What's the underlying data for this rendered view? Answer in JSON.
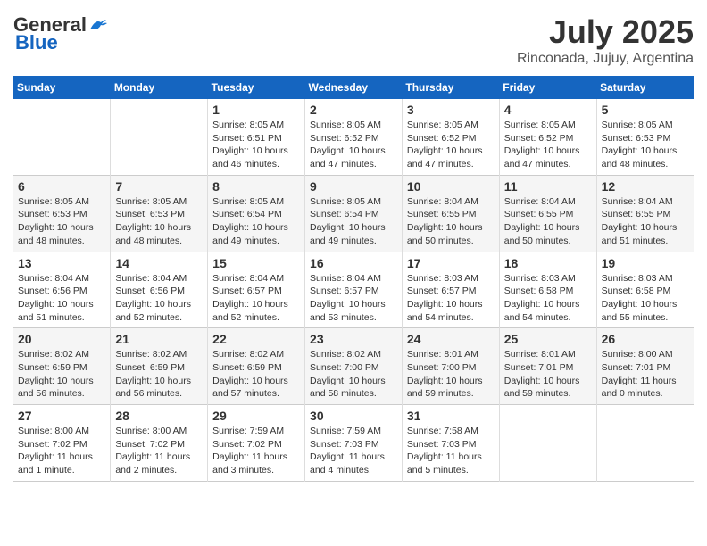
{
  "header": {
    "logo_general": "General",
    "logo_blue": "Blue",
    "month_title": "July 2025",
    "subtitle": "Rinconada, Jujuy, Argentina"
  },
  "days_of_week": [
    "Sunday",
    "Monday",
    "Tuesday",
    "Wednesday",
    "Thursday",
    "Friday",
    "Saturday"
  ],
  "weeks": [
    [
      {
        "day": "",
        "info": ""
      },
      {
        "day": "",
        "info": ""
      },
      {
        "day": "1",
        "info": "Sunrise: 8:05 AM\nSunset: 6:51 PM\nDaylight: 10 hours and 46 minutes."
      },
      {
        "day": "2",
        "info": "Sunrise: 8:05 AM\nSunset: 6:52 PM\nDaylight: 10 hours and 47 minutes."
      },
      {
        "day": "3",
        "info": "Sunrise: 8:05 AM\nSunset: 6:52 PM\nDaylight: 10 hours and 47 minutes."
      },
      {
        "day": "4",
        "info": "Sunrise: 8:05 AM\nSunset: 6:52 PM\nDaylight: 10 hours and 47 minutes."
      },
      {
        "day": "5",
        "info": "Sunrise: 8:05 AM\nSunset: 6:53 PM\nDaylight: 10 hours and 48 minutes."
      }
    ],
    [
      {
        "day": "6",
        "info": "Sunrise: 8:05 AM\nSunset: 6:53 PM\nDaylight: 10 hours and 48 minutes."
      },
      {
        "day": "7",
        "info": "Sunrise: 8:05 AM\nSunset: 6:53 PM\nDaylight: 10 hours and 48 minutes."
      },
      {
        "day": "8",
        "info": "Sunrise: 8:05 AM\nSunset: 6:54 PM\nDaylight: 10 hours and 49 minutes."
      },
      {
        "day": "9",
        "info": "Sunrise: 8:05 AM\nSunset: 6:54 PM\nDaylight: 10 hours and 49 minutes."
      },
      {
        "day": "10",
        "info": "Sunrise: 8:04 AM\nSunset: 6:55 PM\nDaylight: 10 hours and 50 minutes."
      },
      {
        "day": "11",
        "info": "Sunrise: 8:04 AM\nSunset: 6:55 PM\nDaylight: 10 hours and 50 minutes."
      },
      {
        "day": "12",
        "info": "Sunrise: 8:04 AM\nSunset: 6:55 PM\nDaylight: 10 hours and 51 minutes."
      }
    ],
    [
      {
        "day": "13",
        "info": "Sunrise: 8:04 AM\nSunset: 6:56 PM\nDaylight: 10 hours and 51 minutes."
      },
      {
        "day": "14",
        "info": "Sunrise: 8:04 AM\nSunset: 6:56 PM\nDaylight: 10 hours and 52 minutes."
      },
      {
        "day": "15",
        "info": "Sunrise: 8:04 AM\nSunset: 6:57 PM\nDaylight: 10 hours and 52 minutes."
      },
      {
        "day": "16",
        "info": "Sunrise: 8:04 AM\nSunset: 6:57 PM\nDaylight: 10 hours and 53 minutes."
      },
      {
        "day": "17",
        "info": "Sunrise: 8:03 AM\nSunset: 6:57 PM\nDaylight: 10 hours and 54 minutes."
      },
      {
        "day": "18",
        "info": "Sunrise: 8:03 AM\nSunset: 6:58 PM\nDaylight: 10 hours and 54 minutes."
      },
      {
        "day": "19",
        "info": "Sunrise: 8:03 AM\nSunset: 6:58 PM\nDaylight: 10 hours and 55 minutes."
      }
    ],
    [
      {
        "day": "20",
        "info": "Sunrise: 8:02 AM\nSunset: 6:59 PM\nDaylight: 10 hours and 56 minutes."
      },
      {
        "day": "21",
        "info": "Sunrise: 8:02 AM\nSunset: 6:59 PM\nDaylight: 10 hours and 56 minutes."
      },
      {
        "day": "22",
        "info": "Sunrise: 8:02 AM\nSunset: 6:59 PM\nDaylight: 10 hours and 57 minutes."
      },
      {
        "day": "23",
        "info": "Sunrise: 8:02 AM\nSunset: 7:00 PM\nDaylight: 10 hours and 58 minutes."
      },
      {
        "day": "24",
        "info": "Sunrise: 8:01 AM\nSunset: 7:00 PM\nDaylight: 10 hours and 59 minutes."
      },
      {
        "day": "25",
        "info": "Sunrise: 8:01 AM\nSunset: 7:01 PM\nDaylight: 10 hours and 59 minutes."
      },
      {
        "day": "26",
        "info": "Sunrise: 8:00 AM\nSunset: 7:01 PM\nDaylight: 11 hours and 0 minutes."
      }
    ],
    [
      {
        "day": "27",
        "info": "Sunrise: 8:00 AM\nSunset: 7:02 PM\nDaylight: 11 hours and 1 minute."
      },
      {
        "day": "28",
        "info": "Sunrise: 8:00 AM\nSunset: 7:02 PM\nDaylight: 11 hours and 2 minutes."
      },
      {
        "day": "29",
        "info": "Sunrise: 7:59 AM\nSunset: 7:02 PM\nDaylight: 11 hours and 3 minutes."
      },
      {
        "day": "30",
        "info": "Sunrise: 7:59 AM\nSunset: 7:03 PM\nDaylight: 11 hours and 4 minutes."
      },
      {
        "day": "31",
        "info": "Sunrise: 7:58 AM\nSunset: 7:03 PM\nDaylight: 11 hours and 5 minutes."
      },
      {
        "day": "",
        "info": ""
      },
      {
        "day": "",
        "info": ""
      }
    ]
  ]
}
